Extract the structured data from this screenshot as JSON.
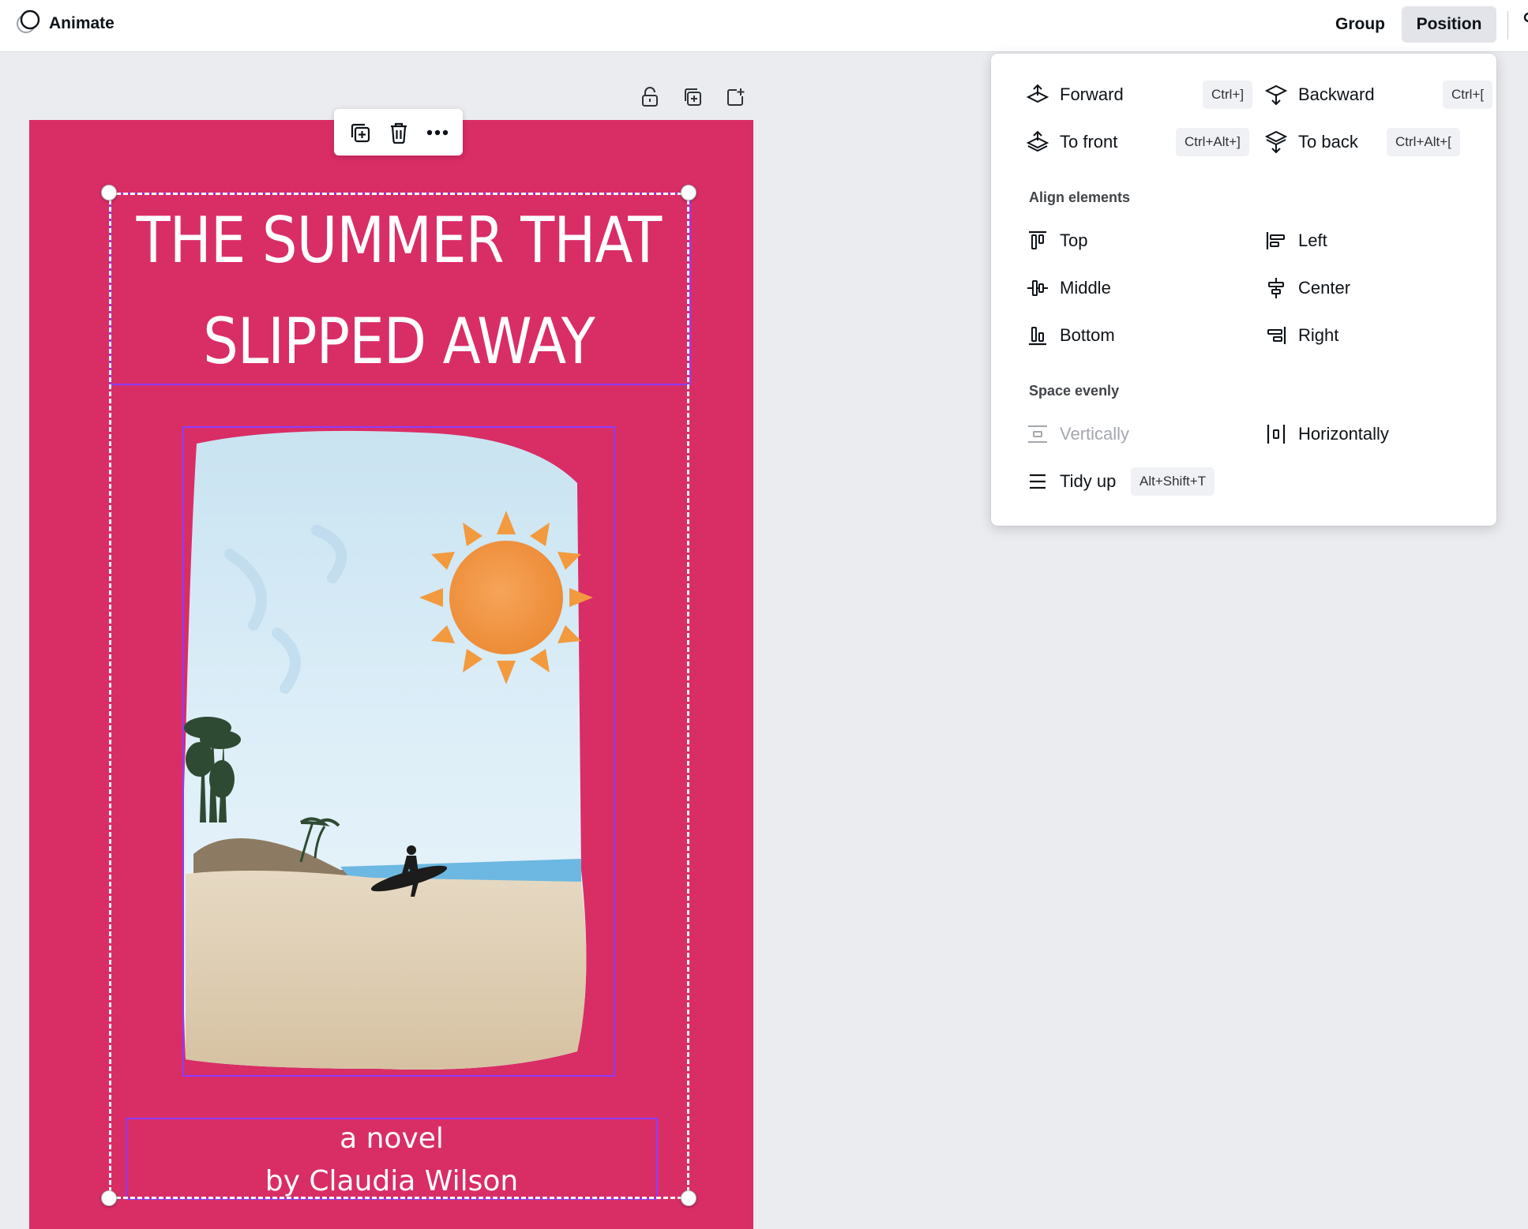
{
  "topbar": {
    "animate_label": "Animate",
    "group_label": "Group",
    "position_label": "Position"
  },
  "page_tools": [
    {
      "name": "lock-icon"
    },
    {
      "name": "duplicate-page-icon"
    },
    {
      "name": "add-page-icon"
    }
  ],
  "element_toolbar": {
    "icons": [
      "duplicate-icon",
      "trash-icon",
      "more-icon"
    ]
  },
  "cover": {
    "title_line1": "THE SUMMER THAT",
    "title_line2": "SLIPPED AWAY",
    "byline_line1": "a novel",
    "byline_line2": "by Claudia Wilson",
    "background_color": "#d92d66"
  },
  "position_panel": {
    "arrange": {
      "forward": {
        "label": "Forward",
        "shortcut": "Ctrl+]"
      },
      "backward": {
        "label": "Backward",
        "shortcut": "Ctrl+["
      },
      "to_front": {
        "label": "To front",
        "shortcut": "Ctrl+Alt+]"
      },
      "to_back": {
        "label": "To back",
        "shortcut": "Ctrl+Alt+["
      }
    },
    "align_heading": "Align elements",
    "align": {
      "top": "Top",
      "left": "Left",
      "middle": "Middle",
      "center": "Center",
      "bottom": "Bottom",
      "right": "Right"
    },
    "space_heading": "Space evenly",
    "space": {
      "vertically": "Vertically",
      "horizontally": "Horizontally",
      "tidy_up": {
        "label": "Tidy up",
        "shortcut": "Alt+Shift+T"
      }
    }
  },
  "colors": {
    "accent": "#8b3dff",
    "cover": "#d92d66",
    "canvas": "#ebecf0"
  }
}
